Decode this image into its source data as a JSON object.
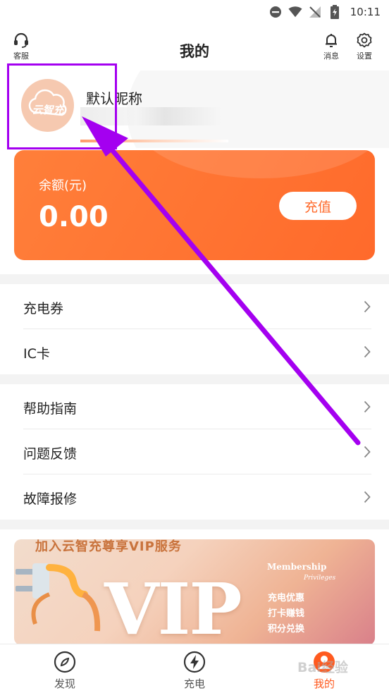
{
  "status_bar": {
    "time": "10:11"
  },
  "header": {
    "title": "我的",
    "support_label": "客服",
    "message_label": "消息",
    "settings_label": "设置"
  },
  "profile": {
    "nickname": "默认昵称",
    "avatar_text": "云智充"
  },
  "balance": {
    "label": "余额(元)",
    "value": "0.00",
    "recharge_label": "充值"
  },
  "menu_group_1": [
    {
      "label": "充电券"
    },
    {
      "label": "IC卡"
    }
  ],
  "menu_group_2": [
    {
      "label": "帮助指南"
    },
    {
      "label": "问题反馈"
    },
    {
      "label": "故障报修"
    }
  ],
  "vip_banner": {
    "headline": "加入云智充尊享VIP服务",
    "big_text": "VIP",
    "membership": "Membership",
    "privileges": "Privileges",
    "perks": [
      "充电优惠",
      "打卡赚钱",
      "积分兑换"
    ]
  },
  "bottom_nav": [
    {
      "label": "发现"
    },
    {
      "label": "充电"
    },
    {
      "label": "我的"
    }
  ],
  "watermark": "Bai经验",
  "colors": {
    "accent": "#ff6a2b",
    "highlight": "#a400f0"
  }
}
